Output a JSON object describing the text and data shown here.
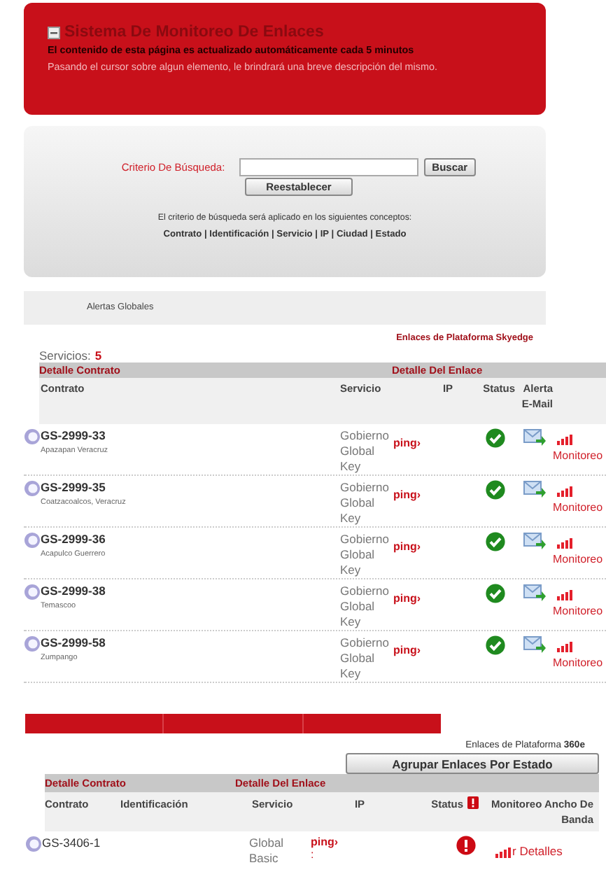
{
  "header": {
    "title": "Sistema De Monitoreo De Enlaces",
    "notice": "El contenido de esta página es actualizado automáticamente cada 5 minutos",
    "hint": "Pasando el cursor sobre algun elemento, le brindrará una breve descripción del mismo."
  },
  "search": {
    "label": "Criterio De Búsqueda:",
    "search_button": "Buscar",
    "reset_button": "Reestablecer",
    "note": "El criterio de búsqueda será aplicado en los siguientes conceptos:",
    "concepts": "Contrato | Identificación | Servicio | IP | Ciudad | Estado"
  },
  "alerts_bar": {
    "label": "Alertas Globales"
  },
  "skyedge": {
    "platform": "Enlaces de Plataforma Skyedge",
    "services_label": "Servicios:",
    "services_count": "5",
    "groups": [
      "Detalle Contrato",
      "Detalle Del Enlace"
    ],
    "columns": [
      "Contrato",
      "Servicio",
      "IP",
      "Status",
      "Alerta E-Mail"
    ],
    "rows": [
      {
        "contract": "GS-2999-33",
        "city": "Apazapan Veracruz",
        "service": "Gobierno Global Key",
        "ping": "ping›",
        "status_ok": true,
        "monitor": "Monitoreo"
      },
      {
        "contract": "GS-2999-35",
        "city": "Coatzacoalcos, Veracruz",
        "service": "Gobierno Global Key",
        "ping": "ping›",
        "status_ok": true,
        "monitor": "Monitoreo"
      },
      {
        "contract": "GS-2999-36",
        "city": "Acapulco Guerrero",
        "service": "Gobierno Global Key",
        "ping": "ping›",
        "status_ok": true,
        "monitor": "Monitoreo"
      },
      {
        "contract": "GS-2999-38",
        "city": "Temascoo",
        "service": "Gobierno Global Key",
        "ping": "ping›",
        "status_ok": true,
        "monitor": "Monitoreo"
      },
      {
        "contract": "GS-2999-58",
        "city": "Zumpango",
        "service": "Gobierno Global Key",
        "ping": "ping›",
        "status_ok": true,
        "monitor": "Monitoreo"
      }
    ]
  },
  "e360": {
    "platform": "Enlaces de Plataforma **360e**",
    "group_button": "Agrupar Enlaces Por Estado",
    "groups": [
      "Detalle Contrato",
      "Detalle Del Enlace"
    ],
    "columns": [
      "Contrato",
      "Identificación",
      "Servicio",
      "IP",
      "Status",
      "Monitoreo Ancho De Banda"
    ],
    "rows": [
      {
        "contract": "GS-3406-1",
        "service": "Global Basic",
        "ping": "ping›",
        "ip": ":",
        "status_ok": false,
        "monitor": "r Detalles"
      }
    ]
  }
}
